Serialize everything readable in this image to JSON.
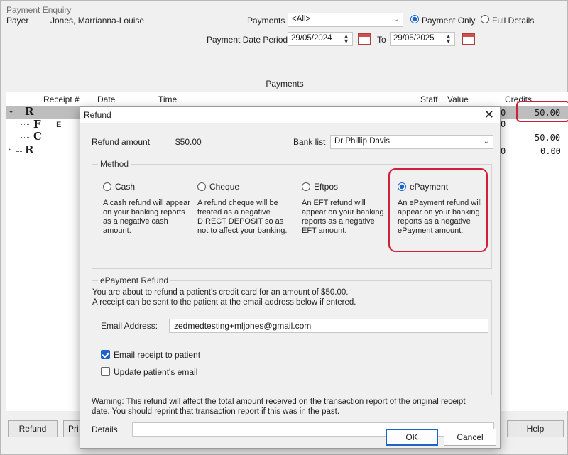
{
  "window": {
    "title": "Payment Enquiry"
  },
  "filters": {
    "payer_label": "Payer",
    "payer_value": "Jones, Marrianna-Louise",
    "payments_label": "Payments",
    "payments_value": "<All>",
    "radio_payment_only": "Payment Only",
    "radio_full_details": "Full Details",
    "date_period_label": "Payment Date Period",
    "date_from": "29/05/2024",
    "to_label": "To",
    "date_to": "29/05/2025"
  },
  "grid": {
    "title": "Payments",
    "columns": [
      "Receipt #",
      "Date",
      "Time",
      "Staff",
      "Value",
      "Credits"
    ],
    "rows": [
      {
        "tree": "R",
        "credit_suffix": "0",
        "credits": "50.00"
      },
      {
        "tree": "F",
        "mid": "E",
        "credit_suffix": "0",
        "credits": ""
      },
      {
        "tree": "C",
        "credit_suffix": "",
        "credits": "50.00"
      },
      {
        "tree": "R",
        "credit_suffix": "0",
        "credits": "0.00"
      }
    ]
  },
  "bottom_buttons": {
    "refund": "Refund",
    "print_partial": "Pri",
    "help": "Help"
  },
  "dialog": {
    "title": "Refund",
    "refund_amount_label": "Refund amount",
    "refund_amount_value": "$50.00",
    "bank_list_label": "Bank list",
    "bank_list_value": "Dr Phillip Davis",
    "method_label": "Method",
    "methods": [
      {
        "label": "Cash",
        "desc": "A cash refund will appear on your banking reports as a negative cash amount.",
        "selected": false
      },
      {
        "label": "Cheque",
        "desc": "A refund cheque will be treated as a negative DIRECT DEPOSIT so as not to affect your banking.",
        "selected": false
      },
      {
        "label": "Eftpos",
        "desc": "An EFT refund will appear on your banking reports as a negative EFT amount.",
        "selected": false
      },
      {
        "label": "ePayment",
        "desc": "An ePayment refund will appear on your banking reports as a negative ePayment amount.",
        "selected": true
      }
    ],
    "epay_group_label": "ePayment Refund",
    "epay_line1": "You are about to refund a patient's credit card for an amount of $50.00.",
    "epay_line2": "A receipt can be sent to the patient at the email address below if entered.",
    "email_label": "Email Address:",
    "email_value": "zedmedtesting+mljones@gmail.com",
    "email_receipt_label": "Email receipt to patient",
    "email_receipt_checked": true,
    "update_email_label": "Update patient's email",
    "update_email_checked": false,
    "warning_line1": "Warning: This refund will affect the total amount received on the transaction report of the original receipt",
    "warning_line2": "date. You should reprint that transaction report if this was in the past.",
    "details_label": "Details",
    "details_value": "",
    "ok_label": "OK",
    "cancel_label": "Cancel"
  },
  "colors": {
    "accent": "#1e63c7",
    "highlight": "#d0203a"
  }
}
